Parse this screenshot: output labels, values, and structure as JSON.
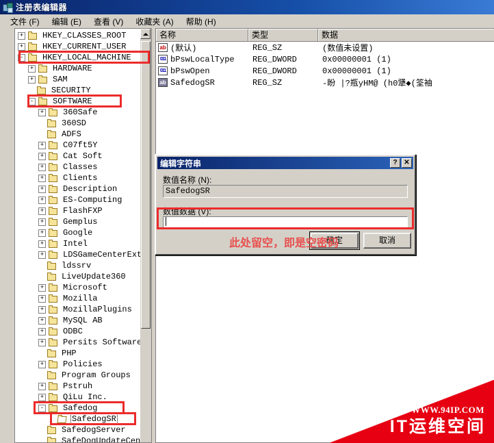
{
  "window": {
    "title": "注册表编辑器",
    "icon": "registry-editor-icon"
  },
  "menu": {
    "items": [
      {
        "label": "文件 (F)"
      },
      {
        "label": "编辑 (E)"
      },
      {
        "label": "查看 (V)"
      },
      {
        "label": "收藏夹 (A)"
      },
      {
        "label": "帮助 (H)"
      }
    ]
  },
  "tree": {
    "nodes": [
      {
        "label": "HKEY_CLASSES_ROOT",
        "depth": 1,
        "expander": "+"
      },
      {
        "label": "HKEY_CURRENT_USER",
        "depth": 1,
        "expander": "+"
      },
      {
        "label": "HKEY_LOCAL_MACHINE",
        "depth": 1,
        "expander": "-"
      },
      {
        "label": "HARDWARE",
        "depth": 2,
        "expander": "+"
      },
      {
        "label": "SAM",
        "depth": 2,
        "expander": "+"
      },
      {
        "label": "SECURITY",
        "depth": 2,
        "expander": ""
      },
      {
        "label": "SOFTWARE",
        "depth": 2,
        "expander": "-"
      },
      {
        "label": "360Safe",
        "depth": 3,
        "expander": "+"
      },
      {
        "label": "360SD",
        "depth": 3,
        "expander": ""
      },
      {
        "label": "ADFS",
        "depth": 3,
        "expander": ""
      },
      {
        "label": "C07ft5Y",
        "depth": 3,
        "expander": "+"
      },
      {
        "label": "Cat Soft",
        "depth": 3,
        "expander": "+"
      },
      {
        "label": "Classes",
        "depth": 3,
        "expander": "+"
      },
      {
        "label": "Clients",
        "depth": 3,
        "expander": "+"
      },
      {
        "label": "Description",
        "depth": 3,
        "expander": "+"
      },
      {
        "label": "ES-Computing",
        "depth": 3,
        "expander": "+"
      },
      {
        "label": "FlashFXP",
        "depth": 3,
        "expander": "+"
      },
      {
        "label": "Gemplus",
        "depth": 3,
        "expander": "+"
      },
      {
        "label": "Google",
        "depth": 3,
        "expander": "+"
      },
      {
        "label": "Intel",
        "depth": 3,
        "expander": "+"
      },
      {
        "label": "LDSGameCenterExt",
        "depth": 3,
        "expander": "+"
      },
      {
        "label": "ldssrv",
        "depth": 3,
        "expander": ""
      },
      {
        "label": "LiveUpdate360",
        "depth": 3,
        "expander": ""
      },
      {
        "label": "Microsoft",
        "depth": 3,
        "expander": "+"
      },
      {
        "label": "Mozilla",
        "depth": 3,
        "expander": "+"
      },
      {
        "label": "MozillaPlugins",
        "depth": 3,
        "expander": "+"
      },
      {
        "label": "MySQL AB",
        "depth": 3,
        "expander": "+"
      },
      {
        "label": "ODBC",
        "depth": 3,
        "expander": "+"
      },
      {
        "label": "Persits Software",
        "depth": 3,
        "expander": "+"
      },
      {
        "label": "PHP",
        "depth": 3,
        "expander": ""
      },
      {
        "label": "Policies",
        "depth": 3,
        "expander": "+"
      },
      {
        "label": "Program Groups",
        "depth": 3,
        "expander": ""
      },
      {
        "label": "Pstruh",
        "depth": 3,
        "expander": "+"
      },
      {
        "label": "QiLu Inc.",
        "depth": 3,
        "expander": "+"
      },
      {
        "label": "Safedog",
        "depth": 3,
        "expander": "-"
      },
      {
        "label": "SafedogSR",
        "depth": 4,
        "expander": "",
        "selected": true,
        "open_folder": true
      },
      {
        "label": "SafedogServer",
        "depth": 3,
        "expander": ""
      },
      {
        "label": "SafeDogUpdateCen",
        "depth": 3,
        "expander": ""
      }
    ]
  },
  "list": {
    "columns": [
      "名称",
      "类型",
      "数据"
    ],
    "rows": [
      {
        "name": "(默认)",
        "type": "REG_SZ",
        "data": "(数值未设置)",
        "icon": "string-value-icon",
        "icon_text": "ab"
      },
      {
        "name": "bPswLocalType",
        "type": "REG_DWORD",
        "data": "0x00000001  (1)",
        "icon": "dword-value-icon",
        "icon_text": "011"
      },
      {
        "name": "bPswOpen",
        "type": "REG_DWORD",
        "data": "0x00000001  (1)",
        "icon": "dword-value-icon",
        "icon_text": "011"
      },
      {
        "name": "SafedogSR",
        "type": "REG_SZ",
        "data": "-盼 |?瓶yHM@ (h0犟◆(筌袖",
        "icon": "string-value-icon",
        "icon_text": "ab",
        "selected": true
      }
    ]
  },
  "dialog": {
    "title": "编辑字符串",
    "help_button": "?",
    "close_button": "✕",
    "name_label": "数值名称 (N):",
    "name_value": "SafedogSR",
    "data_label": "数值数据 (V):",
    "data_value": "",
    "ok_button": "确定",
    "cancel_button": "取消"
  },
  "annotation": {
    "note": "此处留空，即是空密码",
    "color": "#ec2b2b"
  },
  "watermark": {
    "url": "WWW.94IP.COM",
    "name": "IT运维空间",
    "color": "#e60012"
  }
}
